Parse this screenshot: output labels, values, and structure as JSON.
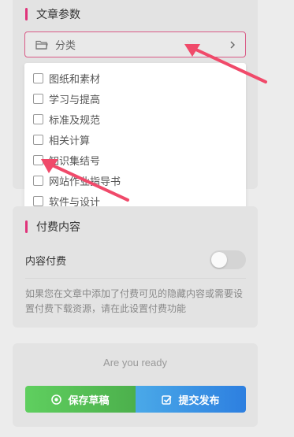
{
  "article_params": {
    "title": "文章参数",
    "category_select": {
      "placeholder": "分类",
      "icon": "folder-icon"
    },
    "category_options": [
      "图纸和素材",
      "学习与提高",
      "标准及规范",
      "相关计算",
      "知识集结号",
      "网站作业指导书",
      "软件与设计"
    ]
  },
  "paid_content": {
    "title": "付费内容",
    "toggle_label": "内容付费",
    "toggle_on": false,
    "description": "如果您在文章中添加了付费可见的隐藏内容或需要设置付费下载资源，请在此设置付费功能"
  },
  "submit": {
    "ready_text": "Are you ready",
    "save_draft_label": "保存草稿",
    "publish_label": "提交发布"
  },
  "colors": {
    "accent": "#e0337a",
    "draft_green": "#4cb04c",
    "publish_blue": "#2d7fe0",
    "annotation_arrow": "#f04a6a"
  }
}
